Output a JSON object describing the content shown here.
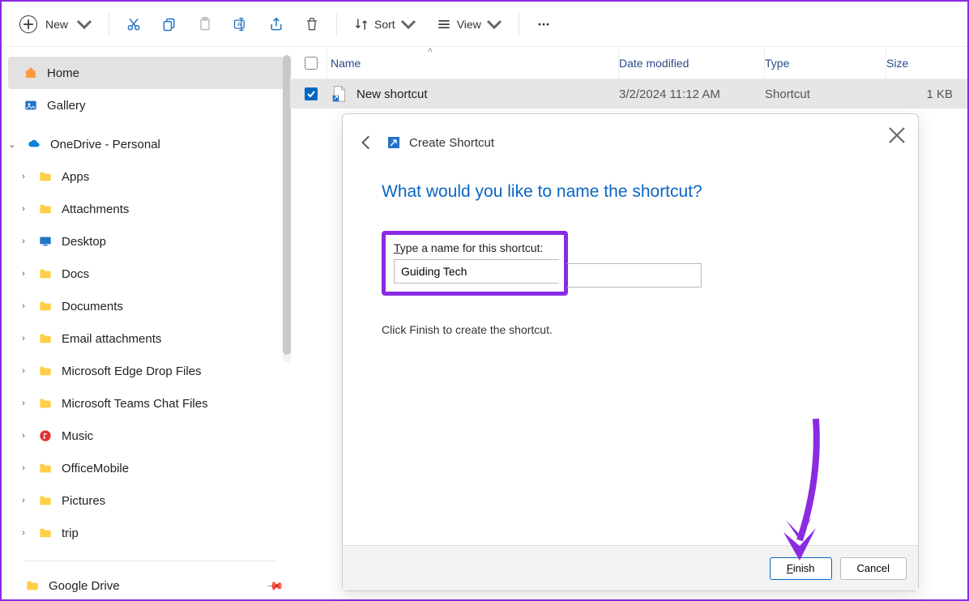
{
  "toolbar": {
    "new_label": "New",
    "sort_label": "Sort",
    "view_label": "View"
  },
  "sidebar": {
    "home": "Home",
    "gallery": "Gallery",
    "onedrive": "OneDrive - Personal",
    "folders": [
      "Apps",
      "Attachments",
      "Desktop",
      "Docs",
      "Documents",
      "Email attachments",
      "Microsoft Edge Drop Files",
      "Microsoft Teams Chat Files",
      "Music",
      "OfficeMobile",
      "Pictures",
      "trip"
    ],
    "google": "Google Drive"
  },
  "columns": {
    "name": "Name",
    "date": "Date modified",
    "type": "Type",
    "size": "Size"
  },
  "file": {
    "name": "New shortcut",
    "date": "3/2/2024 11:12 AM",
    "type": "Shortcut",
    "size": "1 KB"
  },
  "dialog": {
    "title": "Create Shortcut",
    "question": "What would you like to name the shortcut?",
    "field_label_pre": "T",
    "field_label_post": "ype a name for this shortcut:",
    "value": "Guiding Tech",
    "hint": "Click Finish to create the shortcut.",
    "finish_pre": "F",
    "finish_post": "inish",
    "cancel": "Cancel"
  }
}
